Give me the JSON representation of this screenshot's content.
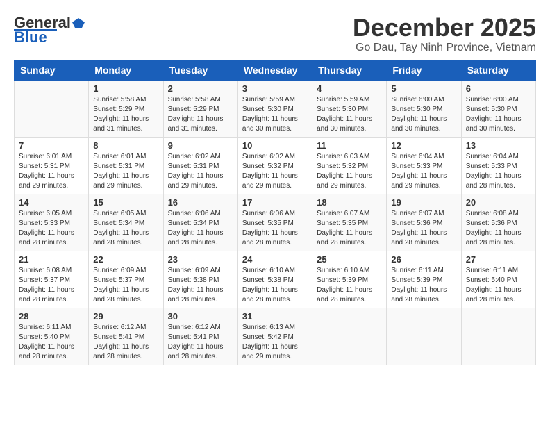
{
  "header": {
    "logo_general": "General",
    "logo_blue": "Blue",
    "month_title": "December 2025",
    "location": "Go Dau, Tay Ninh Province, Vietnam"
  },
  "days_of_week": [
    "Sunday",
    "Monday",
    "Tuesday",
    "Wednesday",
    "Thursday",
    "Friday",
    "Saturday"
  ],
  "weeks": [
    [
      {
        "day": "",
        "info": ""
      },
      {
        "day": "1",
        "info": "Sunrise: 5:58 AM\nSunset: 5:29 PM\nDaylight: 11 hours\nand 31 minutes."
      },
      {
        "day": "2",
        "info": "Sunrise: 5:58 AM\nSunset: 5:29 PM\nDaylight: 11 hours\nand 31 minutes."
      },
      {
        "day": "3",
        "info": "Sunrise: 5:59 AM\nSunset: 5:30 PM\nDaylight: 11 hours\nand 30 minutes."
      },
      {
        "day": "4",
        "info": "Sunrise: 5:59 AM\nSunset: 5:30 PM\nDaylight: 11 hours\nand 30 minutes."
      },
      {
        "day": "5",
        "info": "Sunrise: 6:00 AM\nSunset: 5:30 PM\nDaylight: 11 hours\nand 30 minutes."
      },
      {
        "day": "6",
        "info": "Sunrise: 6:00 AM\nSunset: 5:30 PM\nDaylight: 11 hours\nand 30 minutes."
      }
    ],
    [
      {
        "day": "7",
        "info": "Sunrise: 6:01 AM\nSunset: 5:31 PM\nDaylight: 11 hours\nand 29 minutes."
      },
      {
        "day": "8",
        "info": "Sunrise: 6:01 AM\nSunset: 5:31 PM\nDaylight: 11 hours\nand 29 minutes."
      },
      {
        "day": "9",
        "info": "Sunrise: 6:02 AM\nSunset: 5:31 PM\nDaylight: 11 hours\nand 29 minutes."
      },
      {
        "day": "10",
        "info": "Sunrise: 6:02 AM\nSunset: 5:32 PM\nDaylight: 11 hours\nand 29 minutes."
      },
      {
        "day": "11",
        "info": "Sunrise: 6:03 AM\nSunset: 5:32 PM\nDaylight: 11 hours\nand 29 minutes."
      },
      {
        "day": "12",
        "info": "Sunrise: 6:04 AM\nSunset: 5:33 PM\nDaylight: 11 hours\nand 29 minutes."
      },
      {
        "day": "13",
        "info": "Sunrise: 6:04 AM\nSunset: 5:33 PM\nDaylight: 11 hours\nand 28 minutes."
      }
    ],
    [
      {
        "day": "14",
        "info": "Sunrise: 6:05 AM\nSunset: 5:33 PM\nDaylight: 11 hours\nand 28 minutes."
      },
      {
        "day": "15",
        "info": "Sunrise: 6:05 AM\nSunset: 5:34 PM\nDaylight: 11 hours\nand 28 minutes."
      },
      {
        "day": "16",
        "info": "Sunrise: 6:06 AM\nSunset: 5:34 PM\nDaylight: 11 hours\nand 28 minutes."
      },
      {
        "day": "17",
        "info": "Sunrise: 6:06 AM\nSunset: 5:35 PM\nDaylight: 11 hours\nand 28 minutes."
      },
      {
        "day": "18",
        "info": "Sunrise: 6:07 AM\nSunset: 5:35 PM\nDaylight: 11 hours\nand 28 minutes."
      },
      {
        "day": "19",
        "info": "Sunrise: 6:07 AM\nSunset: 5:36 PM\nDaylight: 11 hours\nand 28 minutes."
      },
      {
        "day": "20",
        "info": "Sunrise: 6:08 AM\nSunset: 5:36 PM\nDaylight: 11 hours\nand 28 minutes."
      }
    ],
    [
      {
        "day": "21",
        "info": "Sunrise: 6:08 AM\nSunset: 5:37 PM\nDaylight: 11 hours\nand 28 minutes."
      },
      {
        "day": "22",
        "info": "Sunrise: 6:09 AM\nSunset: 5:37 PM\nDaylight: 11 hours\nand 28 minutes."
      },
      {
        "day": "23",
        "info": "Sunrise: 6:09 AM\nSunset: 5:38 PM\nDaylight: 11 hours\nand 28 minutes."
      },
      {
        "day": "24",
        "info": "Sunrise: 6:10 AM\nSunset: 5:38 PM\nDaylight: 11 hours\nand 28 minutes."
      },
      {
        "day": "25",
        "info": "Sunrise: 6:10 AM\nSunset: 5:39 PM\nDaylight: 11 hours\nand 28 minutes."
      },
      {
        "day": "26",
        "info": "Sunrise: 6:11 AM\nSunset: 5:39 PM\nDaylight: 11 hours\nand 28 minutes."
      },
      {
        "day": "27",
        "info": "Sunrise: 6:11 AM\nSunset: 5:40 PM\nDaylight: 11 hours\nand 28 minutes."
      }
    ],
    [
      {
        "day": "28",
        "info": "Sunrise: 6:11 AM\nSunset: 5:40 PM\nDaylight: 11 hours\nand 28 minutes."
      },
      {
        "day": "29",
        "info": "Sunrise: 6:12 AM\nSunset: 5:41 PM\nDaylight: 11 hours\nand 28 minutes."
      },
      {
        "day": "30",
        "info": "Sunrise: 6:12 AM\nSunset: 5:41 PM\nDaylight: 11 hours\nand 28 minutes."
      },
      {
        "day": "31",
        "info": "Sunrise: 6:13 AM\nSunset: 5:42 PM\nDaylight: 11 hours\nand 29 minutes."
      },
      {
        "day": "",
        "info": ""
      },
      {
        "day": "",
        "info": ""
      },
      {
        "day": "",
        "info": ""
      }
    ]
  ]
}
